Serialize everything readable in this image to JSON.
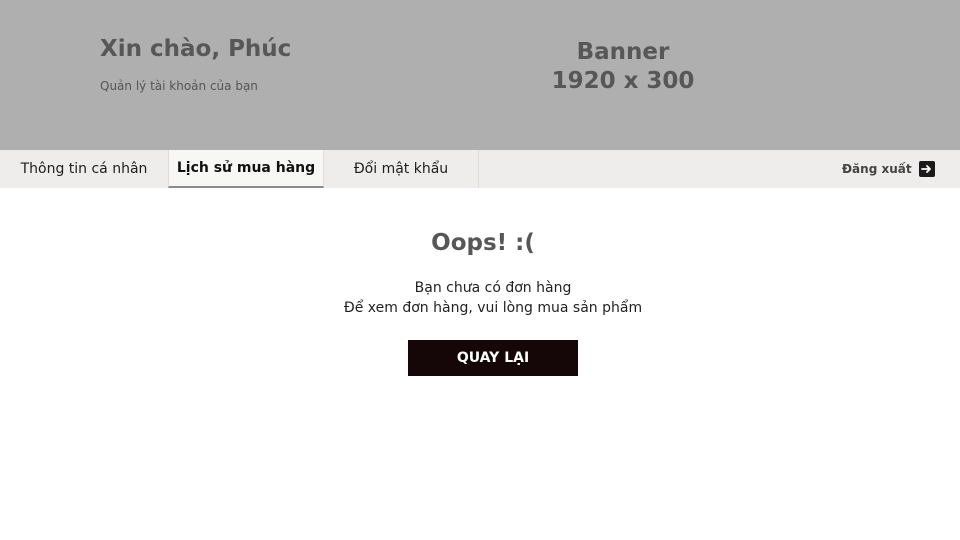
{
  "header": {
    "greeting": "Xin chào, Phúc",
    "subtitle": "Quản lý tài khoản của bạn",
    "banner_line1": "Banner",
    "banner_line2": "1920 x 300"
  },
  "tabs": [
    {
      "label": "Thông tin cá nhân",
      "active": false
    },
    {
      "label": "Lịch sử mua hàng",
      "active": true
    },
    {
      "label": "Đổi mật khẩu",
      "active": false
    }
  ],
  "logout": {
    "label": "Đăng xuất",
    "icon": "logout-arrow-icon"
  },
  "empty_state": {
    "title": "Oops! :(",
    "line1": "Bạn chưa có đơn hàng",
    "line2": "Để xem đơn hàng, vui lòng mua sản phẩm",
    "button_label": "QUAY LẠI"
  },
  "colors": {
    "banner_bg": "#afafaf",
    "tabbar_bg": "#eeedeb",
    "button_bg": "#150707",
    "heading_text": "#575757"
  }
}
